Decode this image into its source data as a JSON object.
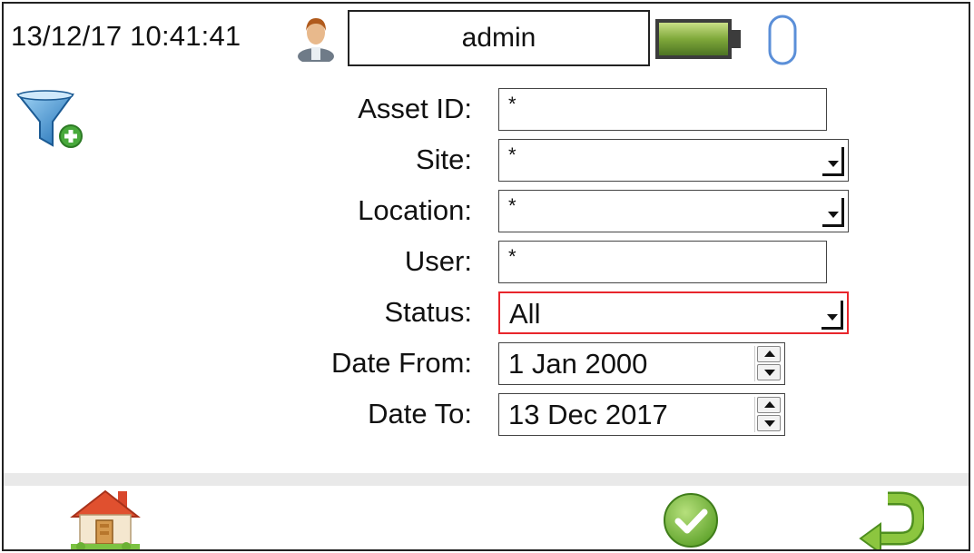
{
  "header": {
    "datetime": "13/12/17 10:41:41",
    "username": "admin",
    "icons": [
      "user-icon",
      "battery-icon",
      "usb-icon"
    ]
  },
  "toolbar": {
    "filter_add_icon": "filter-add-icon"
  },
  "form": {
    "asset_id": {
      "label": "Asset ID:",
      "value": "*"
    },
    "site": {
      "label": "Site:",
      "value": "*"
    },
    "location": {
      "label": "Location:",
      "value": "*"
    },
    "user": {
      "label": "User:",
      "value": "*"
    },
    "status": {
      "label": "Status:",
      "value": "All"
    },
    "date_from": {
      "label": "Date From:",
      "value": "1 Jan 2000"
    },
    "date_to": {
      "label": "Date To:",
      "value": "13 Dec 2017"
    }
  },
  "footer": {
    "icons": [
      "home-icon",
      "confirm-icon",
      "back-icon"
    ]
  },
  "colors": {
    "status_border": "#e8262c",
    "confirm_green": "#7cc242",
    "back_green": "#8cc63f",
    "filter_blue": "#3a8fd0"
  }
}
